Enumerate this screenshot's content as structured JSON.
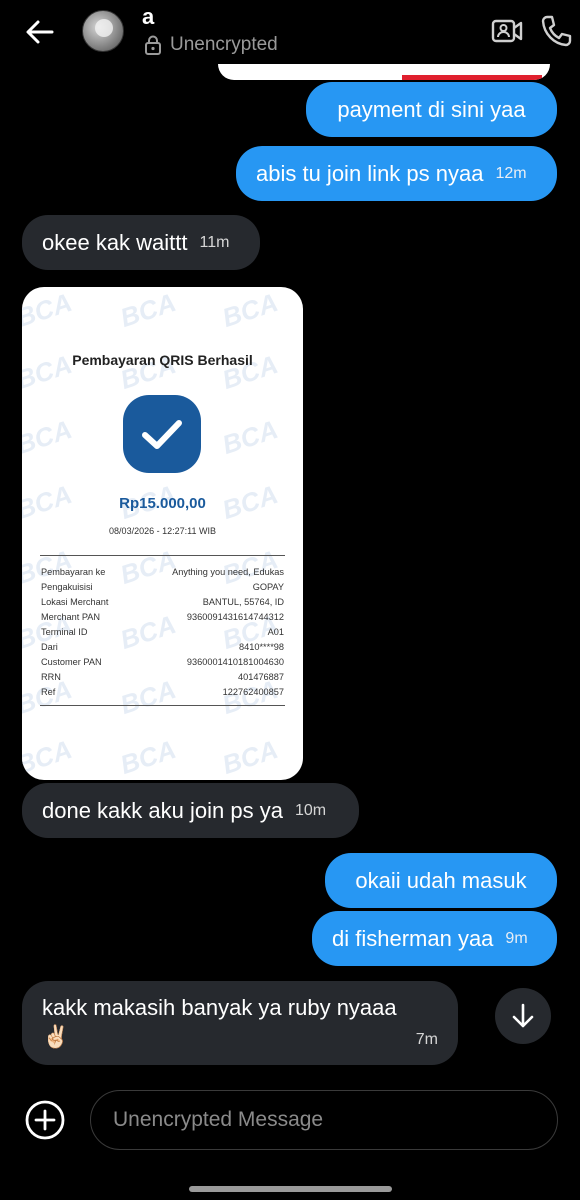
{
  "header": {
    "contact_name": "a",
    "encryption_status": "Unencrypted",
    "icons": [
      "back-arrow-icon",
      "avatar",
      "lock-icon",
      "video-call-icon",
      "phone-call-icon"
    ]
  },
  "messages": [
    {
      "direction": "out",
      "text": "payment di sini yaa",
      "time": ""
    },
    {
      "direction": "out",
      "text": "abis tu join link ps nyaa",
      "time": "12m"
    },
    {
      "direction": "in",
      "text": "okee kak waittt",
      "time": "11m"
    },
    {
      "direction": "in",
      "type": "image",
      "text": "",
      "time": ""
    },
    {
      "direction": "in",
      "text": "done kakk aku join ps ya",
      "time": "10m"
    },
    {
      "direction": "out",
      "text": "okaii udah masuk",
      "time": ""
    },
    {
      "direction": "out",
      "text": "di fisherman yaa",
      "time": "9m"
    },
    {
      "direction": "in",
      "text": "kakk makasih banyak ya ruby nyaaa",
      "emoji": "✌🏻",
      "time": "7m"
    }
  ],
  "receipt": {
    "watermark": "BCA",
    "title": "Pembayaran QRIS Berhasil",
    "amount": "Rp15.000,00",
    "datetime": "08/03/2026 - 12:27:11 WIB",
    "rows": [
      {
        "label": "Pembayaran ke",
        "value": "Anything you need, Edukas"
      },
      {
        "label": "Pengakuisisi",
        "value": "GOPAY"
      },
      {
        "label": "Lokasi Merchant",
        "value": "BANTUL, 55764, ID"
      },
      {
        "label": "Merchant PAN",
        "value": "9360091431614744312"
      },
      {
        "label": "Terminal ID",
        "value": "A01"
      },
      {
        "label": "Dari",
        "value": "8410****98"
      },
      {
        "label": "Customer PAN",
        "value": "9360001410181004630"
      },
      {
        "label": "RRN",
        "value": "401476887"
      },
      {
        "label": "Ref",
        "value": "122762400857"
      }
    ],
    "accent_color": "#1a5a9c"
  },
  "composer": {
    "placeholder": "Unencrypted Message"
  },
  "colors": {
    "outgoing_bubble": "#2797f3",
    "incoming_bubble": "#26292e",
    "background": "#000000"
  }
}
